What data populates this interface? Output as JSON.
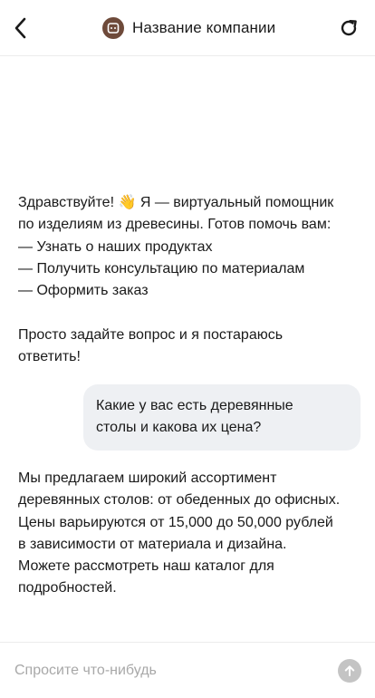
{
  "header": {
    "back_icon": "chevron-left-icon",
    "logo_icon": "chat-bot-icon",
    "company_name": "Название компании",
    "refresh_icon": "refresh-icon"
  },
  "messages": [
    {
      "role": "bot",
      "text": "Здравствуйте! 👋 Я — виртуальный помощник\nпо изделиям из древесины. Готов помочь вам:\n— Узнать о наших продуктах\n— Получить консультацию по материалам\n— Оформить заказ\n\nПросто задайте вопрос и я постараюсь\nответить!"
    },
    {
      "role": "user",
      "text": "Какие у вас есть деревянные\nстолы и какова их цена?"
    },
    {
      "role": "bot",
      "text": "Мы предлагаем широкий ассортимент\nдеревянных столов: от обеденных до офисных.\nЦены варьируются от 15,000 до 50,000 рублей\nв зависимости от материала и дизайна.\nМожете рассмотреть наш каталог для\nподробностей."
    }
  ],
  "input": {
    "placeholder": "Спросите что-нибудь",
    "value": "",
    "send_icon": "arrow-up-icon"
  },
  "colors": {
    "logo_bg": "#6e4a3a",
    "user_bubble_bg": "#eef0f3",
    "send_button_bg": "#c4c4c4",
    "placeholder": "#a8a8a8"
  }
}
